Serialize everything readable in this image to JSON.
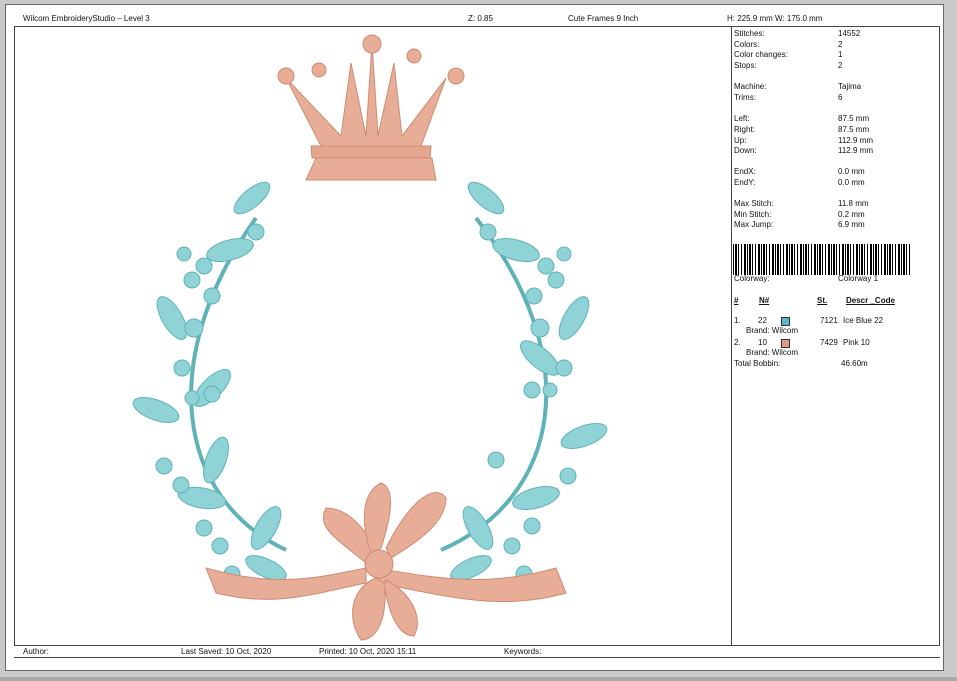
{
  "header": {
    "app_title": "Wilcom EmbroideryStudio – Level 3",
    "zoom": "Z: 0.85",
    "design_name": "Cute Frames 9  Inch",
    "dimensions": "H: 225.9 mm   W: 175.0 mm"
  },
  "stats": {
    "stitches_label": "Stitches:",
    "stitches": "14552",
    "colors_label": "Colors:",
    "colors": "2",
    "color_changes_label": "Color changes:",
    "color_changes": "1",
    "stops_label": "Stops:",
    "stops": "2",
    "machine_label": "Machine:",
    "machine": "Tajima",
    "trims_label": "Trims:",
    "trims": "6",
    "left_label": "Left:",
    "left": "87.5 mm",
    "right_label": "Right:",
    "right": "87.5 mm",
    "up_label": "Up:",
    "up": "112.9 mm",
    "down_label": "Down:",
    "down": "112.9 mm",
    "endx_label": "EndX:",
    "endx": "0.0 mm",
    "endy_label": "EndY:",
    "endy": "0.0 mm",
    "max_stitch_label": "Max Stitch:",
    "max_stitch": "11.8 mm",
    "min_stitch_label": "Min Stitch:",
    "min_stitch": "0.2 mm",
    "max_jump_label": "Max Jump:",
    "max_jump": "6.9 mm",
    "colorway_label": "Colorway:",
    "colorway": "Colorway 1"
  },
  "table": {
    "col_num": "#",
    "col_n": "N#",
    "col_st": "St.",
    "col_desc": "Descr _Code",
    "rows": [
      {
        "idx": "1.",
        "n": "22",
        "color": "#5fb3cf",
        "st": "7121",
        "desc": "Ice Blue 22",
        "brand": "Brand: Wilcom"
      },
      {
        "idx": "2.",
        "n": "10",
        "color": "#e29a86",
        "st": "7429",
        "desc": "Pink 10",
        "brand": "Brand: Wilcom"
      }
    ],
    "total_bobbin_label": "Total Bobbin:",
    "total_bobbin": "46.60m"
  },
  "footer": {
    "author": "Author:",
    "last_saved": "Last Saved: 10 Oct, 2020",
    "printed": "Printed: 10 Oct, 2020 15:11",
    "keywords": "Keywords:"
  },
  "art_colors": {
    "blue": "#8fd3d6",
    "blue_dark": "#5fb3b8",
    "pink": "#e8ad96",
    "pink_dark": "#cf8a73"
  }
}
